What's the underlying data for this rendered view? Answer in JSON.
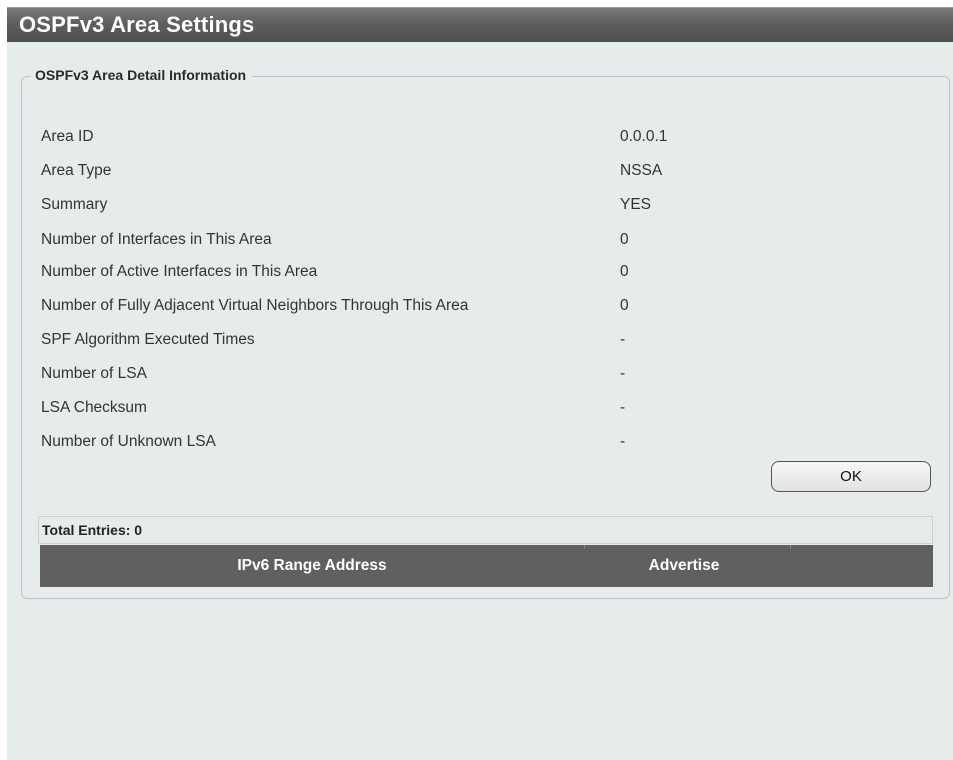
{
  "window": {
    "title": "OSPFv3 Area Settings"
  },
  "detail": {
    "legend": "OSPFv3 Area Detail Information",
    "rows": [
      {
        "label": "Area ID",
        "value": "0.0.0.1"
      },
      {
        "label": "Area Type",
        "value": "NSSA"
      },
      {
        "label": "Summary",
        "value": "YES"
      },
      {
        "label": "Number of Interfaces in This Area",
        "value": "0"
      },
      {
        "label": "Number of Active Interfaces in This Area",
        "value": "0"
      },
      {
        "label": "Number of Fully Adjacent Virtual Neighbors Through This Area",
        "value": "0"
      },
      {
        "label": "SPF Algorithm Executed Times",
        "value": "-"
      },
      {
        "label": "Number of LSA",
        "value": "-"
      },
      {
        "label": "LSA Checksum",
        "value": "-"
      },
      {
        "label": "Number of Unknown LSA",
        "value": "-"
      }
    ],
    "ok_label": "OK"
  },
  "table": {
    "total_entries": "Total Entries: 0",
    "columns": [
      "IPv6 Range Address",
      "Advertise"
    ],
    "rows": []
  },
  "colors": {
    "title_bar": "#5f5f5f",
    "page_background": "#e6ecec",
    "table_header": "#606060"
  }
}
